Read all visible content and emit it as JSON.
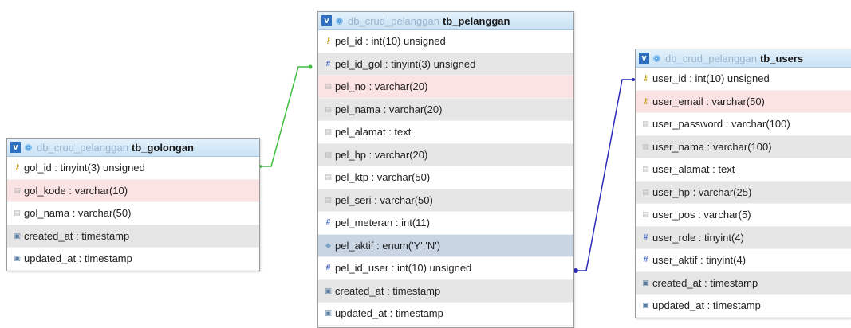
{
  "colors": {
    "link_left": "#3fbf3f",
    "link_right": "#2a2ab8",
    "header_bg": "#c9e2f5"
  },
  "tables": [
    {
      "id": "tb_golongan",
      "db": "db_crud_pelanggan",
      "name": "tb_golongan",
      "columns": [
        {
          "icon": "key-icon",
          "text": "gol_id : tinyint(3) unsigned",
          "bg": "white"
        },
        {
          "icon": "field-icon",
          "text": "gol_kode : varchar(10)",
          "bg": "pink"
        },
        {
          "icon": "field-icon",
          "text": "gol_nama : varchar(50)",
          "bg": "white"
        },
        {
          "icon": "timestamp-icon",
          "text": "created_at : timestamp",
          "bg": "gray"
        },
        {
          "icon": "timestamp-icon",
          "text": "updated_at : timestamp",
          "bg": "white"
        }
      ]
    },
    {
      "id": "tb_pelanggan",
      "db": "db_crud_pelanggan",
      "name": "tb_pelanggan",
      "columns": [
        {
          "icon": "key-icon",
          "text": "pel_id : int(10) unsigned",
          "bg": "white"
        },
        {
          "icon": "hash-icon",
          "text": "pel_id_gol : tinyint(3) unsigned",
          "bg": "gray"
        },
        {
          "icon": "field-icon",
          "text": "pel_no : varchar(20)",
          "bg": "pink"
        },
        {
          "icon": "field-icon",
          "text": "pel_nama : varchar(20)",
          "bg": "gray"
        },
        {
          "icon": "field-icon",
          "text": "pel_alamat : text",
          "bg": "white"
        },
        {
          "icon": "field-icon",
          "text": "pel_hp : varchar(20)",
          "bg": "gray"
        },
        {
          "icon": "field-icon",
          "text": "pel_ktp : varchar(50)",
          "bg": "white"
        },
        {
          "icon": "field-icon",
          "text": "pel_seri : varchar(50)",
          "bg": "gray"
        },
        {
          "icon": "hash-icon",
          "text": "pel_meteran : int(11)",
          "bg": "white"
        },
        {
          "icon": "enum-icon",
          "text": "pel_aktif : enum('Y','N')",
          "bg": "blue"
        },
        {
          "icon": "hash-icon",
          "text": "pel_id_user : int(10) unsigned",
          "bg": "white"
        },
        {
          "icon": "timestamp-icon",
          "text": "created_at : timestamp",
          "bg": "gray"
        },
        {
          "icon": "timestamp-icon",
          "text": "updated_at : timestamp",
          "bg": "white"
        }
      ]
    },
    {
      "id": "tb_users",
      "db": "db_crud_pelanggan",
      "name": "tb_users",
      "columns": [
        {
          "icon": "key-icon",
          "text": "user_id : int(10) unsigned",
          "bg": "white"
        },
        {
          "icon": "key-icon",
          "text": "user_email : varchar(50)",
          "bg": "pink"
        },
        {
          "icon": "field-icon",
          "text": "user_password : varchar(100)",
          "bg": "white"
        },
        {
          "icon": "field-icon",
          "text": "user_nama : varchar(100)",
          "bg": "gray"
        },
        {
          "icon": "field-icon",
          "text": "user_alamat : text",
          "bg": "white"
        },
        {
          "icon": "field-icon",
          "text": "user_hp : varchar(25)",
          "bg": "gray"
        },
        {
          "icon": "field-icon",
          "text": "user_pos : varchar(5)",
          "bg": "white"
        },
        {
          "icon": "hash-icon",
          "text": "user_role : tinyint(4)",
          "bg": "gray"
        },
        {
          "icon": "hash-icon",
          "text": "user_aktif : tinyint(4)",
          "bg": "white"
        },
        {
          "icon": "timestamp-icon",
          "text": "created_at : timestamp",
          "bg": "gray"
        },
        {
          "icon": "timestamp-icon",
          "text": "updated_at : timestamp",
          "bg": "white"
        }
      ]
    }
  ],
  "relations": [
    {
      "from": "tb_golongan.gol_id",
      "to": "tb_pelanggan.pel_id_gol"
    },
    {
      "from": "tb_users.user_id",
      "to": "tb_pelanggan.pel_id_user"
    }
  ]
}
